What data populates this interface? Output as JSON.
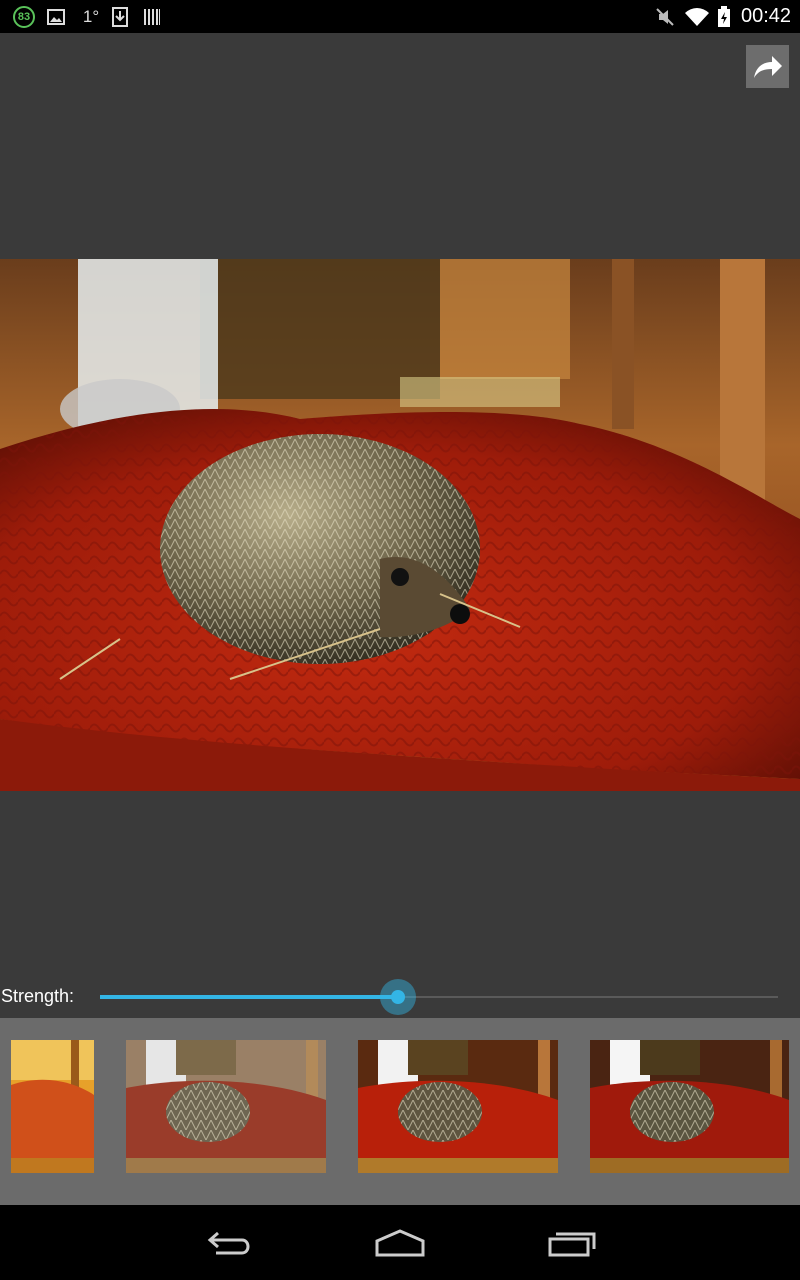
{
  "status_bar": {
    "battery_circle_value": "83",
    "temperature": "1°",
    "time": "00:42",
    "icons": [
      "gallery-icon",
      "download-icon",
      "barcode-icon",
      "mute-icon",
      "wifi-icon",
      "battery-icon"
    ]
  },
  "toolbar": {
    "share_icon": "share-icon"
  },
  "editor": {
    "strength_label": "Strength:",
    "strength_value": 0.44
  },
  "filters": {
    "items": [
      {
        "name": "filter-warm"
      },
      {
        "name": "filter-faded"
      },
      {
        "name": "filter-vivid"
      },
      {
        "name": "filter-contrast"
      }
    ]
  },
  "nav": {
    "icons": [
      "back-icon",
      "home-icon",
      "recents-icon"
    ]
  },
  "colors": {
    "accent": "#33b5e5",
    "background": "#3a3a3a",
    "strip": "#6b6b6b"
  }
}
